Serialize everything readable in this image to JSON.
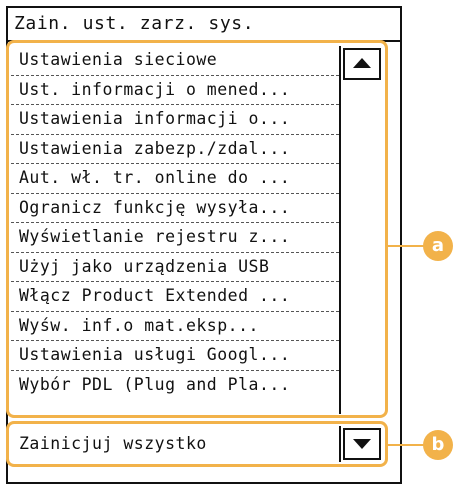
{
  "screen": {
    "title": "Zain. ust. zarz. sys."
  },
  "menu": {
    "items": [
      {
        "label": "Ustawienia sieciowe"
      },
      {
        "label": "Ust. informacji o mened..."
      },
      {
        "label": "Ustawienia informacji o..."
      },
      {
        "label": "Ustawienia zabezp./zdal..."
      },
      {
        "label": "Aut. wł. tr. online do ..."
      },
      {
        "label": "Ogranicz funkcję wysyła..."
      },
      {
        "label": "Wyświetlanie rejestru z..."
      },
      {
        "label": "Użyj jako urządzenia USB"
      },
      {
        "label": "Włącz Product Extended ..."
      },
      {
        "label": "Wyśw. inf.o mat.eksp..."
      },
      {
        "label": "Ustawienia usługi Googl..."
      },
      {
        "label": "Wybór PDL (Plug and Pla..."
      }
    ]
  },
  "bottom": {
    "reset_label": "Zainicjuj wszystko"
  },
  "controls": {
    "scroll_up_icon": "triangle-up-icon",
    "scroll_down_icon": "triangle-down-icon"
  },
  "callouts": {
    "a": "a",
    "b": "b"
  },
  "colors": {
    "highlight": "#f2b24a",
    "frame": "#111111",
    "background": "#ffffff"
  }
}
